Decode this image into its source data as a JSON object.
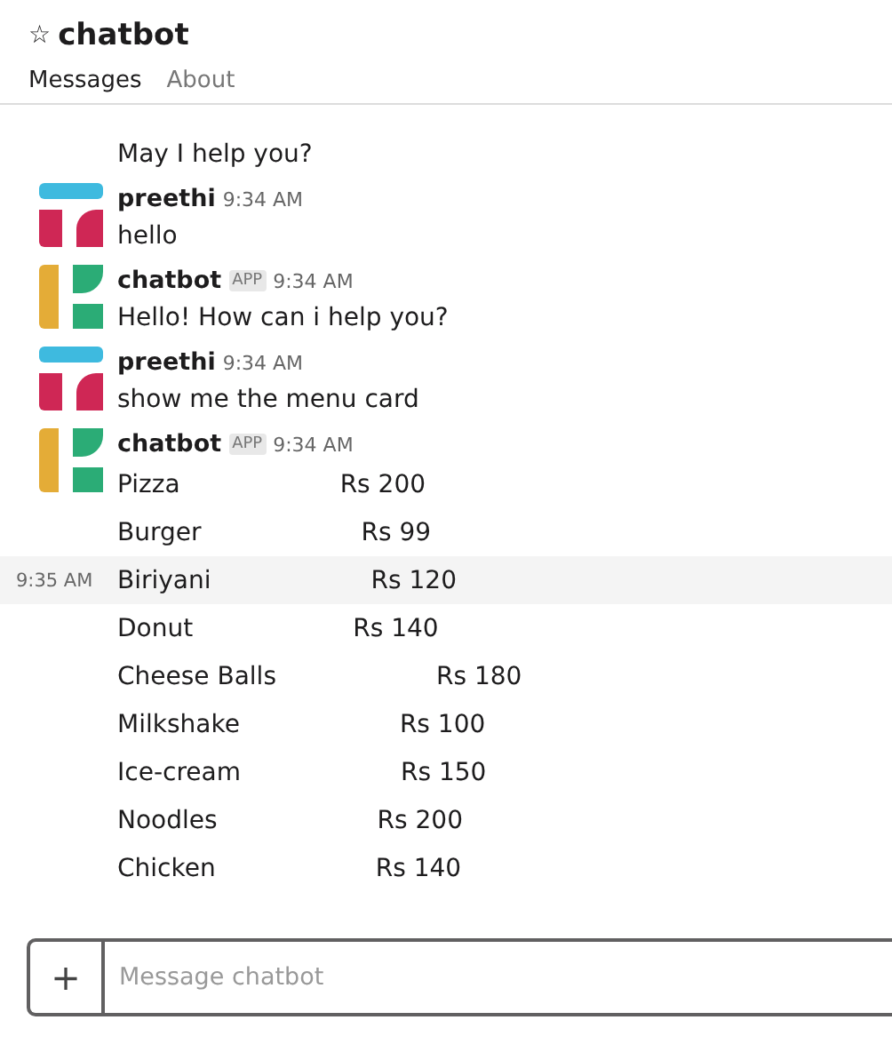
{
  "channel": {
    "star": "☆",
    "title": "chatbot"
  },
  "tabs": [
    {
      "label": "Messages",
      "selected": true
    },
    {
      "label": "About",
      "selected": false
    }
  ],
  "messages": [
    {
      "kind": "continuation",
      "lines": [
        {
          "kind": "text",
          "text": "May I help you?"
        }
      ]
    },
    {
      "kind": "user",
      "sender": "preethi",
      "time": "9:34 AM",
      "lines": [
        {
          "kind": "text",
          "text": "hello"
        }
      ]
    },
    {
      "kind": "bot",
      "sender": "chatbot",
      "badge": "APP",
      "time": "9:34 AM",
      "lines": [
        {
          "kind": "text",
          "text": "Hello! How can i help you?"
        }
      ]
    },
    {
      "kind": "user",
      "sender": "preethi",
      "time": "9:34 AM",
      "lines": [
        {
          "kind": "text",
          "text": "show me the menu card"
        }
      ]
    },
    {
      "kind": "bot",
      "sender": "chatbot",
      "badge": "APP",
      "time": "9:34 AM",
      "lines": [
        {
          "kind": "menu",
          "name": "Pizza",
          "price": "Rs 200"
        },
        {
          "kind": "menu",
          "name": "Burger",
          "price": "Rs 99"
        },
        {
          "kind": "menu",
          "name": "Biriyani",
          "price": "Rs 120",
          "hover_time": "9:35 AM"
        },
        {
          "kind": "menu",
          "name": "Donut",
          "price": "Rs 140"
        },
        {
          "kind": "menu",
          "name": "Cheese Balls",
          "price": "Rs 180"
        },
        {
          "kind": "menu",
          "name": "Milkshake",
          "price": "Rs 100"
        },
        {
          "kind": "menu",
          "name": "Ice-cream",
          "price": "Rs 150"
        },
        {
          "kind": "menu",
          "name": "Noodles",
          "price": "Rs 200"
        },
        {
          "kind": "menu",
          "name": "Chicken",
          "price": "Rs 140"
        }
      ]
    }
  ],
  "composer": {
    "add_label": "+",
    "placeholder": "Message chatbot"
  }
}
